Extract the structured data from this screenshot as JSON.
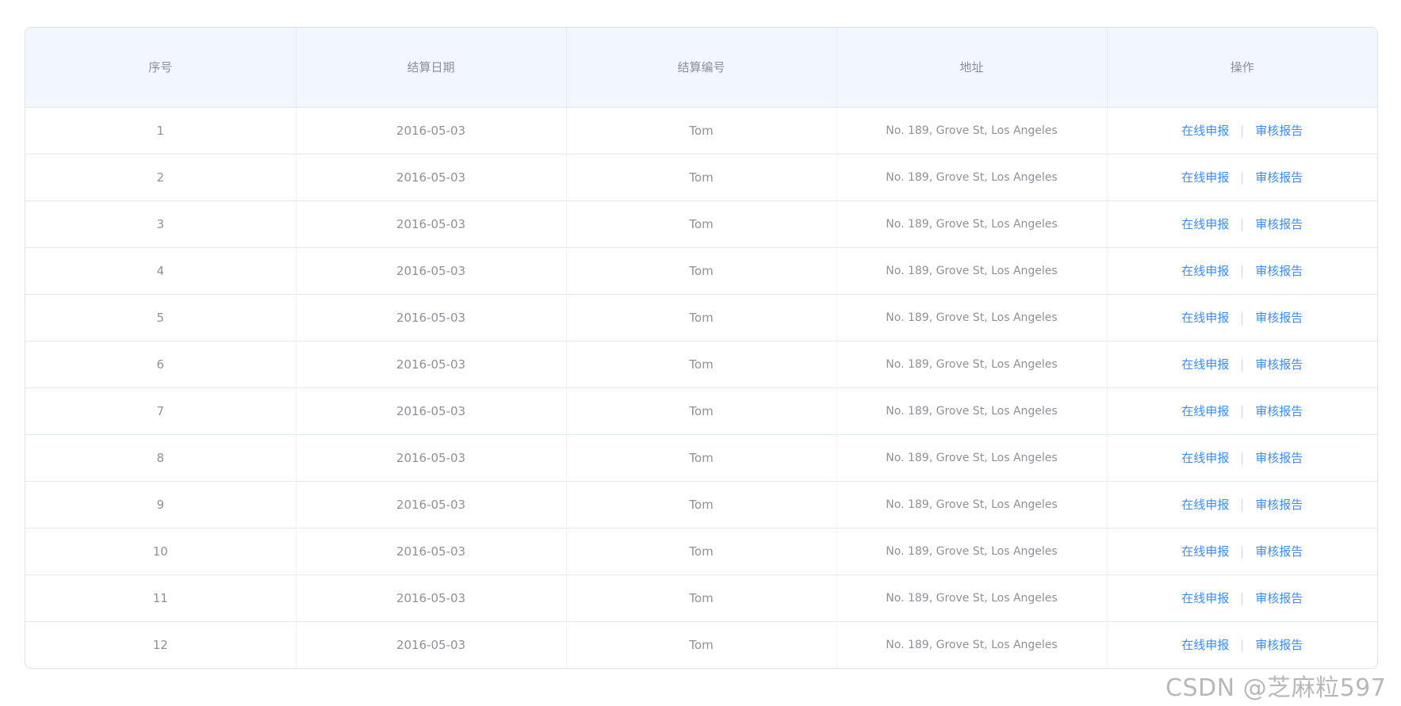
{
  "table": {
    "headers": [
      "序号",
      "结算日期",
      "结算编号",
      "地址",
      "操作"
    ],
    "rows": [
      {
        "index": "1",
        "date": "2016-05-03",
        "name": "Tom",
        "address": "No. 189, Grove St, Los Angeles"
      },
      {
        "index": "2",
        "date": "2016-05-03",
        "name": "Tom",
        "address": "No. 189, Grove St, Los Angeles"
      },
      {
        "index": "3",
        "date": "2016-05-03",
        "name": "Tom",
        "address": "No. 189, Grove St, Los Angeles"
      },
      {
        "index": "4",
        "date": "2016-05-03",
        "name": "Tom",
        "address": "No. 189, Grove St, Los Angeles"
      },
      {
        "index": "5",
        "date": "2016-05-03",
        "name": "Tom",
        "address": "No. 189, Grove St, Los Angeles"
      },
      {
        "index": "6",
        "date": "2016-05-03",
        "name": "Tom",
        "address": "No. 189, Grove St, Los Angeles"
      },
      {
        "index": "7",
        "date": "2016-05-03",
        "name": "Tom",
        "address": "No. 189, Grove St, Los Angeles"
      },
      {
        "index": "8",
        "date": "2016-05-03",
        "name": "Tom",
        "address": "No. 189, Grove St, Los Angeles"
      },
      {
        "index": "9",
        "date": "2016-05-03",
        "name": "Tom",
        "address": "No. 189, Grove St, Los Angeles"
      },
      {
        "index": "10",
        "date": "2016-05-03",
        "name": "Tom",
        "address": "No. 189, Grove St, Los Angeles"
      },
      {
        "index": "11",
        "date": "2016-05-03",
        "name": "Tom",
        "address": "No. 189, Grove St, Los Angeles"
      },
      {
        "index": "12",
        "date": "2016-05-03",
        "name": "Tom",
        "address": "No. 189, Grove St, Los Angeles"
      }
    ],
    "actions": {
      "primary": "在线申报",
      "secondary": "审核报告"
    }
  },
  "watermark": "CSDN @芝麻粒597",
  "colors": {
    "header_bg": "#f1f6ff",
    "link": "#3d8cff",
    "text": "#8d9199",
    "border": "#d6e4f8"
  }
}
